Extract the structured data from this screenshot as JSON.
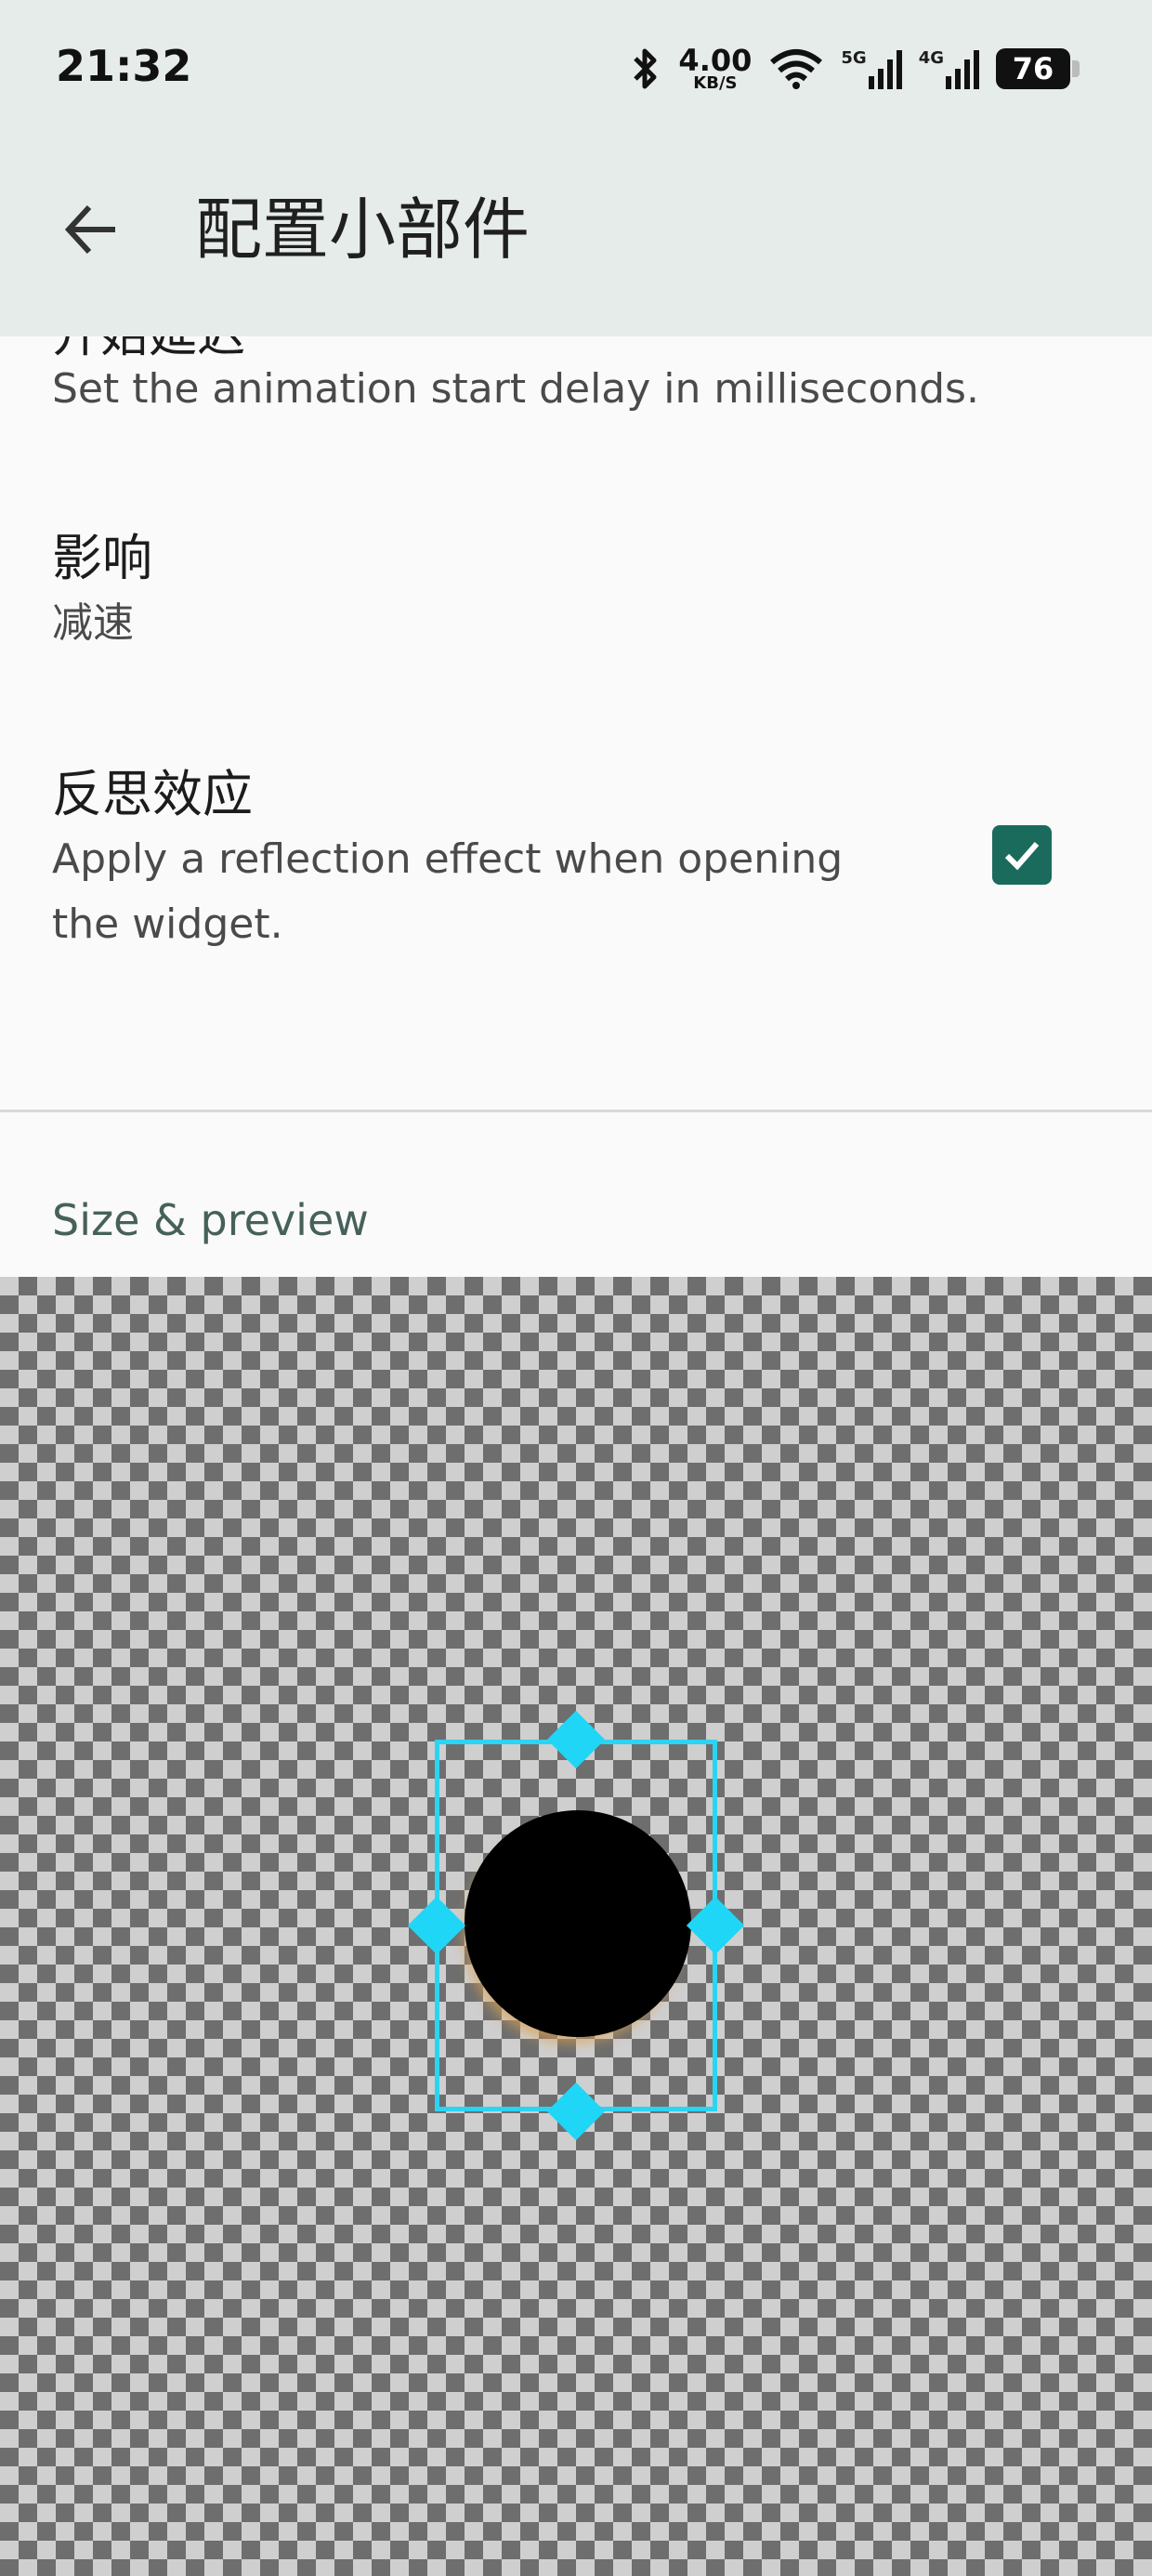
{
  "status_bar": {
    "time": "21:32",
    "net_speed_value": "4.00",
    "net_speed_unit": "KB/S",
    "signal1_label": "5G",
    "signal2_label": "4G",
    "battery": "76"
  },
  "app_bar": {
    "title": "配置小部件",
    "back_icon": "arrow-left-icon"
  },
  "settings": {
    "partial_title": "开始延迟",
    "partial_summary": "Set the animation start delay in milliseconds.",
    "effect_title": "影响",
    "effect_value": "减速",
    "reflection_title": "反思效应",
    "reflection_summary_line1": "Apply a reflection effect when opening",
    "reflection_summary_line2": "the widget.",
    "reflection_checked": true
  },
  "section": {
    "header": "Size & preview"
  },
  "colors": {
    "accent": "#1b6b5c",
    "handle": "#1fd6f7",
    "header_bg": "#e6ece9"
  }
}
